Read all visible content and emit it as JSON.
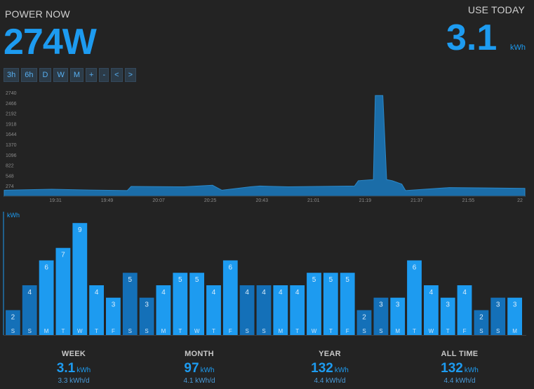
{
  "header": {
    "power_label": "POWER NOW",
    "power_value": "274W",
    "use_label": "USE TODAY",
    "use_value": "3.1",
    "use_unit": "kWh"
  },
  "range_buttons": [
    "3h",
    "6h",
    "D",
    "W",
    "M",
    "+",
    "-",
    "<",
    ">"
  ],
  "colors": {
    "accent": "#1d9bf0",
    "bar_weekday": "#1d9bf0",
    "bar_weekend": "#1470b8",
    "area_fill": "#1b6da8",
    "background": "#232323"
  },
  "chart_data": [
    {
      "type": "area",
      "y_ticks": [
        "274",
        "548",
        "822",
        "1096",
        "1370",
        "1644",
        "1918",
        "2192",
        "2466",
        "2740"
      ],
      "ylim": [
        0,
        2740
      ],
      "x_ticks": [
        "19:31",
        "19:49",
        "20:07",
        "20:25",
        "20:43",
        "21:01",
        "21:19",
        "21:37",
        "21:55",
        "22"
      ],
      "xlim": [
        19.25,
        22.0
      ],
      "x": [
        19.25,
        19.5,
        19.7,
        19.9,
        19.92,
        20.2,
        20.35,
        20.4,
        20.45,
        20.55,
        20.6,
        20.75,
        21.1,
        21.12,
        21.2,
        21.21,
        21.25,
        21.27,
        21.3,
        21.35,
        21.37,
        21.6,
        21.8,
        22.0
      ],
      "y": [
        160,
        185,
        165,
        150,
        260,
        250,
        290,
        160,
        190,
        250,
        270,
        250,
        270,
        410,
        440,
        2660,
        2660,
        440,
        410,
        320,
        150,
        230,
        220,
        210
      ]
    },
    {
      "type": "bar",
      "ylabel": "kWh",
      "categories": [
        "S",
        "S",
        "M",
        "T",
        "W",
        "T",
        "F",
        "S",
        "S",
        "M",
        "T",
        "W",
        "T",
        "F",
        "S",
        "S",
        "M",
        "T",
        "W",
        "T",
        "F",
        "S",
        "S",
        "M",
        "T",
        "W",
        "T",
        "F",
        "S",
        "S",
        "M"
      ],
      "values": [
        2,
        4,
        6,
        7,
        9,
        4,
        3,
        5,
        3,
        4,
        5,
        5,
        4,
        6,
        4,
        4,
        4,
        4,
        5,
        5,
        5,
        2,
        3,
        3,
        6,
        4,
        3,
        4,
        2,
        3,
        3
      ],
      "ylim": [
        0,
        9.8
      ]
    }
  ],
  "stats": [
    {
      "label": "WEEK",
      "value": "3.1",
      "unit": "kWh",
      "avg": "3.3 kWh/d"
    },
    {
      "label": "MONTH",
      "value": "97",
      "unit": "kWh",
      "avg": "4.1 kWh/d"
    },
    {
      "label": "YEAR",
      "value": "132",
      "unit": "kWh",
      "avg": "4.4 kWh/d"
    },
    {
      "label": "ALL TIME",
      "value": "132",
      "unit": "kWh",
      "avg": "4.4 kWh/d"
    }
  ]
}
